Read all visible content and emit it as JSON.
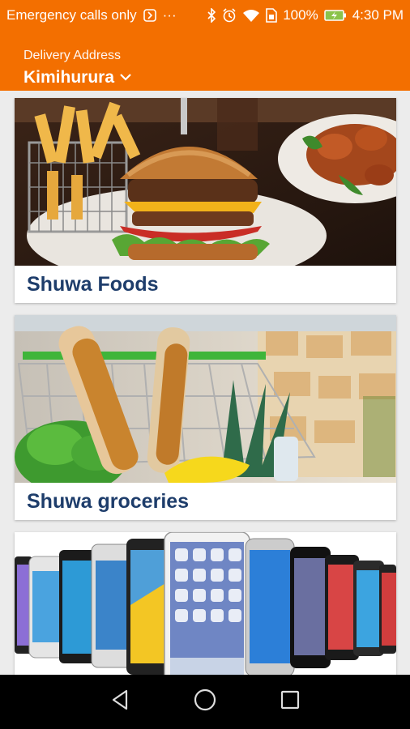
{
  "status_bar": {
    "carrier_text": "Emergency calls only",
    "more_glyph": "···",
    "battery_percent": "100%",
    "time": "4:30 PM",
    "icons": [
      "app-notification-icon",
      "bluetooth-icon",
      "alarm-icon",
      "wifi-icon",
      "sim-icon",
      "battery-charging-icon"
    ]
  },
  "header": {
    "label": "Delivery Address",
    "address": "Kimihurura",
    "background": "#f36f00"
  },
  "cards": [
    {
      "title": "Shuwa Foods",
      "image": "food-burger-fries-image"
    },
    {
      "title": "Shuwa groceries",
      "image": "grocery-cart-image"
    },
    {
      "title": "",
      "image": "smartphones-image"
    }
  ],
  "navbar": {
    "icons": [
      "back-icon",
      "home-icon",
      "recents-icon"
    ]
  },
  "colors": {
    "accent": "#f36f00",
    "card_title": "#1e3d6b",
    "navbar": "#000000"
  }
}
